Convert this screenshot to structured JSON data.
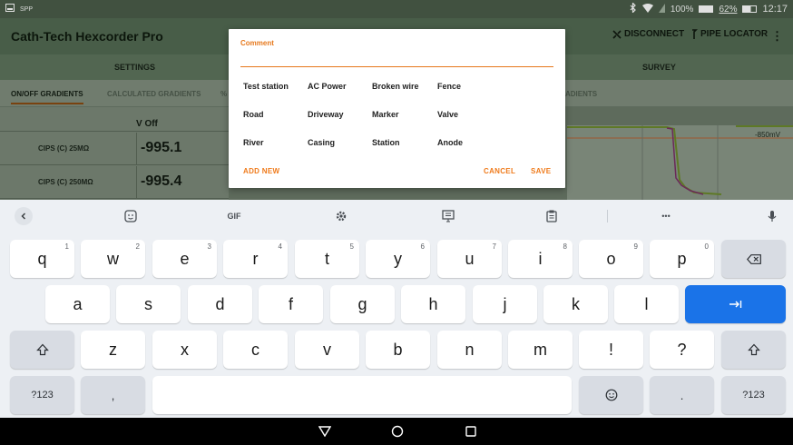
{
  "status_bar": {
    "left_text": "SPP",
    "battery_text": "100%",
    "battery2_text": "62%",
    "clock": "12:17"
  },
  "app": {
    "title": "Cath-Tech Hexcorder Pro",
    "actions": {
      "disconnect": "DISCONNECT",
      "pipe_locator": "PIPE LOCATOR",
      "more": "⋮"
    },
    "nav_tabs": {
      "settings": "SETTINGS",
      "survey": "SURVEY"
    },
    "sub_tabs": {
      "onoff": "ON/OFF GRADIENTS",
      "calculated": "CALCULATED GRADIENTS",
      "partial": "%",
      "right": "ADIENTS"
    },
    "table": {
      "header": "V Off",
      "rows": [
        {
          "label": "CIPS (C) 25MΩ",
          "value": "-995.1"
        },
        {
          "label": "CIPS (C) 250MΩ",
          "value": "-995.4"
        }
      ]
    },
    "chart_label": "-850mV"
  },
  "dialog": {
    "label": "Comment",
    "input_value": "",
    "chips": [
      [
        "Test station",
        "AC Power",
        "Broken wire",
        "Fence"
      ],
      [
        "Road",
        "Driveway",
        "Marker",
        "Valve"
      ],
      [
        "River",
        "Casing",
        "Station",
        "Anode"
      ]
    ],
    "add_new": "ADD NEW",
    "cancel": "CANCEL",
    "save": "SAVE"
  },
  "keyboard": {
    "toolbar": {
      "gif": "GIF",
      "more": "•••"
    },
    "row1": [
      {
        "ch": "q",
        "hint": "1"
      },
      {
        "ch": "w",
        "hint": "2"
      },
      {
        "ch": "e",
        "hint": "3"
      },
      {
        "ch": "r",
        "hint": "4"
      },
      {
        "ch": "t",
        "hint": "5"
      },
      {
        "ch": "y",
        "hint": "6"
      },
      {
        "ch": "u",
        "hint": "7"
      },
      {
        "ch": "i",
        "hint": "8"
      },
      {
        "ch": "o",
        "hint": "9"
      },
      {
        "ch": "p",
        "hint": "0"
      }
    ],
    "row2": [
      "a",
      "s",
      "d",
      "f",
      "g",
      "h",
      "j",
      "k",
      "l"
    ],
    "row3": [
      "z",
      "x",
      "c",
      "v",
      "b",
      "n",
      "m",
      "!",
      "?"
    ],
    "symbols_label": "?123",
    "comma": ",",
    "period": "."
  }
}
